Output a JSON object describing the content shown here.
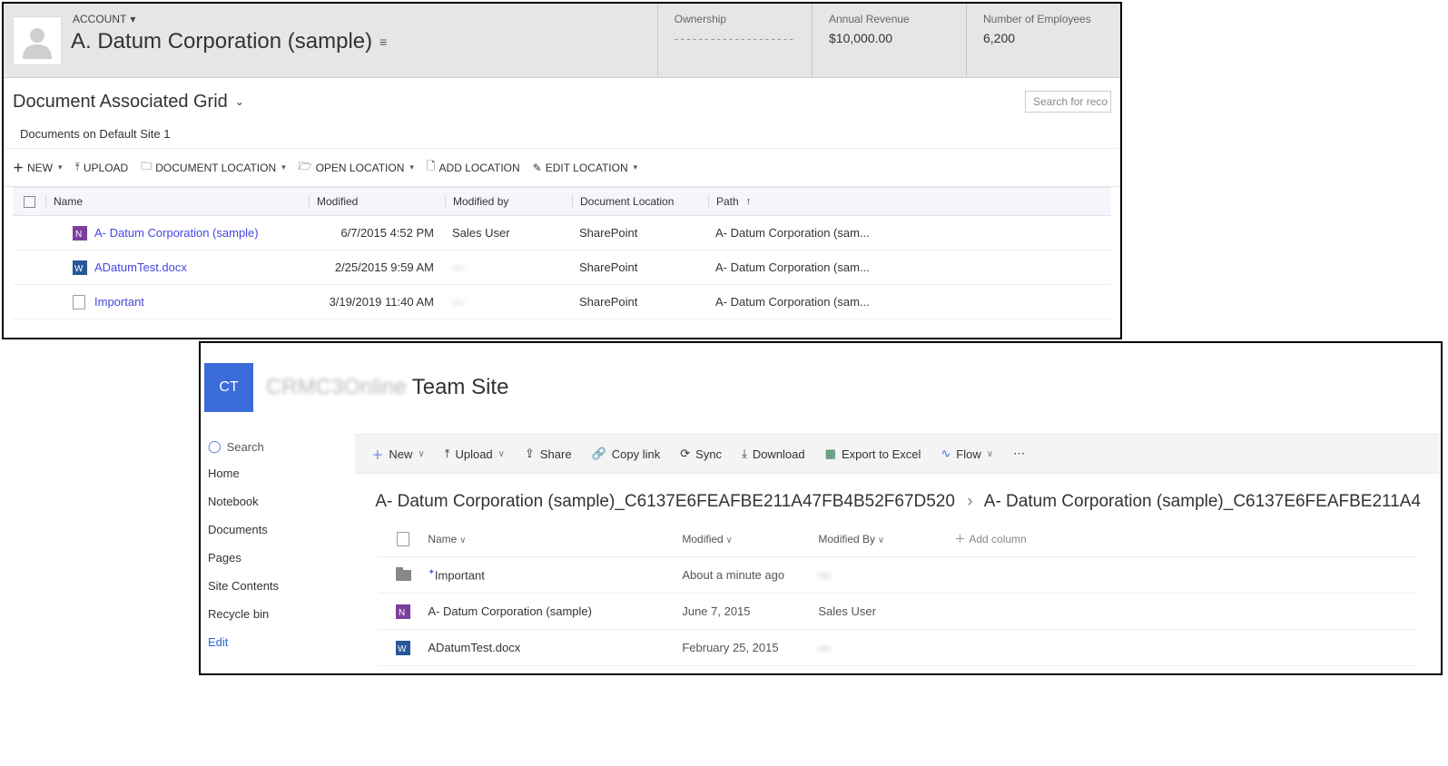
{
  "crm": {
    "entity_label": "ACCOUNT",
    "entity_name": "A. Datum Corporation (sample)",
    "header_fields": [
      {
        "label": "Ownership",
        "value": "--------------------",
        "dashes": true
      },
      {
        "label": "Annual Revenue",
        "value": "$10,000.00"
      },
      {
        "label": "Number of Employees",
        "value": "6,200"
      }
    ],
    "view_title": "Document Associated Grid",
    "search_placeholder": "Search for reco",
    "site_label": "Documents on Default Site 1",
    "toolbar": {
      "new": "NEW",
      "upload": "UPLOAD",
      "doc_location": "DOCUMENT LOCATION",
      "open_location": "OPEN LOCATION",
      "add_location": "ADD LOCATION",
      "edit_location": "EDIT LOCATION"
    },
    "columns": {
      "name": "Name",
      "modified": "Modified",
      "modified_by": "Modified by",
      "doc_location": "Document Location",
      "path": "Path"
    },
    "rows": [
      {
        "icon": "onenote",
        "name": "A- Datum Corporation (sample)",
        "modified": "6/7/2015 4:52 PM",
        "modified_by": "Sales User",
        "location": "SharePoint",
        "path": "A- Datum Corporation (sam..."
      },
      {
        "icon": "word",
        "name": "ADatumTest.docx",
        "modified": "2/25/2015 9:59 AM",
        "modified_by": "—",
        "blur_modby": true,
        "location": "SharePoint",
        "path": "A- Datum Corporation (sam..."
      },
      {
        "icon": "doc",
        "name": "Important",
        "modified": "3/19/2019 11:40 AM",
        "modified_by": "—",
        "blur_modby": true,
        "location": "SharePoint",
        "path": "A- Datum Corporation (sam..."
      }
    ]
  },
  "sp": {
    "logo_text": "CT",
    "site_prefix": "CRMC3Online",
    "site_name": "Team Site",
    "search": "Search",
    "nav": [
      "Home",
      "Notebook",
      "Documents",
      "Pages",
      "Site Contents",
      "Recycle bin",
      "Edit"
    ],
    "toolbar": {
      "new": "New",
      "upload": "Upload",
      "share": "Share",
      "copylink": "Copy link",
      "sync": "Sync",
      "download": "Download",
      "export": "Export to Excel",
      "flow": "Flow"
    },
    "breadcrumb": {
      "a": "A- Datum Corporation (sample)_C6137E6FEAFBE211A47FB4B52F67D520",
      "b": "A- Datum Corporation (sample)_C6137E6FEAFBE211A4"
    },
    "columns": {
      "name": "Name",
      "modified": "Modified",
      "modified_by": "Modified By",
      "add": "Add column"
    },
    "rows": [
      {
        "icon": "folder",
        "name": "Important",
        "modified": "About a minute ago",
        "modified_by": "—",
        "blur_modby": true
      },
      {
        "icon": "onenote",
        "name": "A- Datum Corporation (sample)",
        "modified": "June 7, 2015",
        "modified_by": "Sales User"
      },
      {
        "icon": "word",
        "name": "ADatumTest.docx",
        "modified": "February 25, 2015",
        "modified_by": "—",
        "blur_modby": true
      }
    ]
  }
}
